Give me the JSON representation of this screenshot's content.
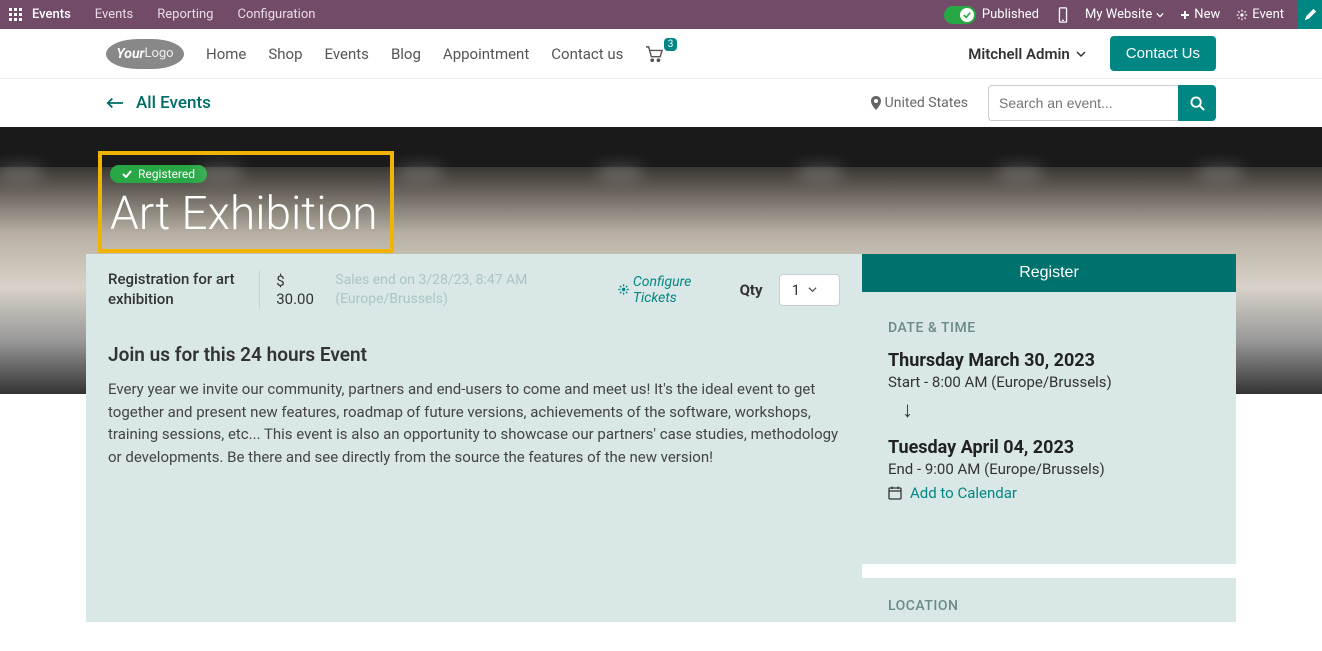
{
  "topbar": {
    "brand": "Events",
    "menu": [
      "Events",
      "Reporting",
      "Configuration"
    ],
    "published": "Published",
    "my_website": "My Website",
    "new": "New",
    "event": "Event"
  },
  "navbar": {
    "links": [
      "Home",
      "Shop",
      "Events",
      "Blog",
      "Appointment",
      "Contact us"
    ],
    "cart_count": "3",
    "user": "Mitchell Admin",
    "contact": "Contact Us"
  },
  "breadcrumb": {
    "all_events": "All Events",
    "location": "United States",
    "search_placeholder": "Search an event..."
  },
  "hero": {
    "registered": "Registered",
    "title": "Art Exhibition"
  },
  "registration": {
    "name": "Registration for art exhibition",
    "price": "$ 30.00",
    "sales_end": "Sales end on 3/28/23, 8:47 AM (Europe/Brussels)",
    "configure": "Configure Tickets",
    "qty_label": "Qty",
    "qty_value": "1",
    "register": "Register"
  },
  "description": {
    "heading": "Join us for this 24 hours Event",
    "body": "Every year we invite our community, partners and end-users to come and meet us! It's the ideal event to get together and present new features, roadmap of future versions, achievements of the software, workshops, training sessions, etc... This event is also an opportunity to showcase our partners' case studies, methodology or developments. Be there and see directly from the source the features of the new version!"
  },
  "datetime": {
    "heading": "DATE & TIME",
    "start_day": "Thursday March 30, 2023",
    "start_line": "Start - 8:00 AM (Europe/Brussels)",
    "end_day": "Tuesday April 04, 2023",
    "end_line": "End - 9:00 AM (Europe/Brussels)",
    "add_cal": "Add to Calendar"
  },
  "location_section": {
    "heading": "LOCATION"
  }
}
